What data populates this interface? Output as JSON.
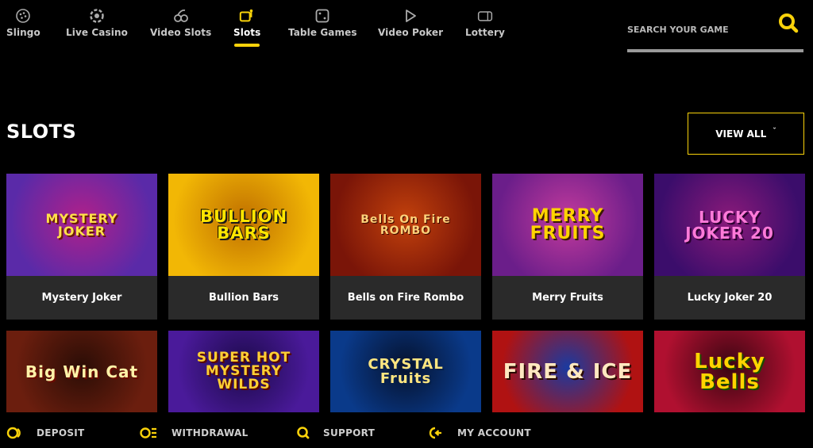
{
  "nav": {
    "items": [
      {
        "label": "Slingo",
        "icon": "slingo-icon",
        "active": false
      },
      {
        "label": "Live Casino",
        "icon": "live-casino-icon",
        "active": false
      },
      {
        "label": "Video Slots",
        "icon": "video-slots-icon",
        "active": false
      },
      {
        "label": "Slots",
        "icon": "slots-icon",
        "active": true
      },
      {
        "label": "Table Games",
        "icon": "table-games-icon",
        "active": false
      },
      {
        "label": "Video Poker",
        "icon": "video-poker-icon",
        "active": false
      },
      {
        "label": "Lottery",
        "icon": "lottery-icon",
        "active": false
      }
    ]
  },
  "search": {
    "placeholder": "SEARCH YOUR GAME",
    "value": ""
  },
  "section": {
    "title": "SLOTS",
    "view_all_label": "VIEW ALL"
  },
  "games": [
    {
      "title": "Mystery Joker",
      "art": [
        "MYSTERY",
        "JOKER"
      ],
      "colors": [
        "#5a2aa8",
        "#b0208a"
      ]
    },
    {
      "title": "Bullion Bars",
      "art": [
        "BULLION",
        "BARS"
      ],
      "colors": [
        "#f2b705",
        "#c07000"
      ]
    },
    {
      "title": "Bells on Fire Rombo",
      "art": [
        "Bells On Fire",
        "ROMBO"
      ],
      "colors": [
        "#7a1508",
        "#c2410c"
      ]
    },
    {
      "title": "Merry Fruits",
      "art": [
        "MERRY",
        "FRUITS"
      ],
      "colors": [
        "#6b1e8a",
        "#c23a9c"
      ]
    },
    {
      "title": "Lucky Joker 20",
      "art": [
        "LUCKY",
        "JOKER 20"
      ],
      "colors": [
        "#3b0d6b",
        "#8a1a7a"
      ]
    },
    {
      "title": "",
      "art": [
        "Big Win Cat"
      ],
      "colors": [
        "#6b1e0e",
        "#2b0d06"
      ]
    },
    {
      "title": "",
      "art": [
        "SUPER HOT",
        "MYSTERY",
        "WILDS"
      ],
      "colors": [
        "#4a1a9a",
        "#1c0a4a"
      ]
    },
    {
      "title": "",
      "art": [
        "CRYSTAL",
        "Fruits"
      ],
      "colors": [
        "#0a3a8a",
        "#05122e"
      ]
    },
    {
      "title": "",
      "art": [
        "FIRE & ICE"
      ],
      "colors": [
        "#b01212",
        "#1a3aa0"
      ]
    },
    {
      "title": "",
      "art": [
        "Lucky",
        "Bells"
      ],
      "colors": [
        "#b01030",
        "#3a0612"
      ]
    }
  ],
  "footer": {
    "items": [
      {
        "label": "DEPOSIT",
        "icon": "deposit-icon"
      },
      {
        "label": "WITHDRAWAL",
        "icon": "withdrawal-icon"
      },
      {
        "label": "SUPPORT",
        "icon": "support-icon"
      },
      {
        "label": "MY ACCOUNT",
        "icon": "my-account-icon"
      }
    ]
  },
  "colors": {
    "accent": "#f9d20a",
    "caption_bg": "#2a2a2a",
    "background": "#000000"
  }
}
